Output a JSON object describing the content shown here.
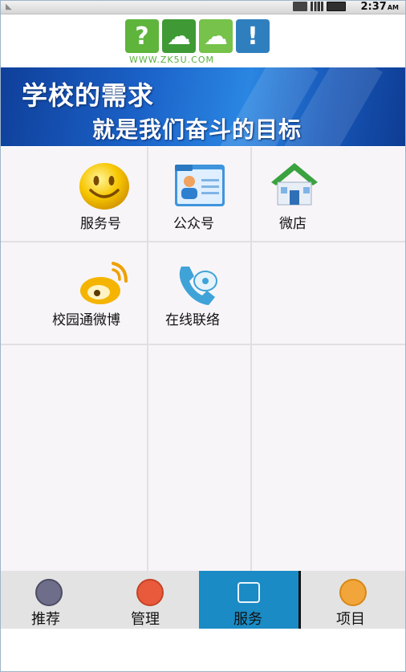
{
  "status_bar": {
    "time": "2:37",
    "ampm": "AM",
    "icons": [
      "usb-icon",
      "signal-icon",
      "battery-icon"
    ]
  },
  "header": {
    "logo_url": "WWW.ZK5U.COM"
  },
  "banner": {
    "line1": "学校的需求",
    "line2": "就是我们奋斗的目标"
  },
  "services": [
    {
      "label": "服务号",
      "icon": "smiley-icon"
    },
    {
      "label": "公众号",
      "icon": "contact-card-icon"
    },
    {
      "label": "微店",
      "icon": "house-icon"
    },
    {
      "label": "校园通微博",
      "icon": "weibo-icon"
    },
    {
      "label": "在线联络",
      "icon": "telephone-icon"
    }
  ],
  "bottom_nav": [
    {
      "label": "推荐",
      "icon": "recommend-icon",
      "active": false
    },
    {
      "label": "管理",
      "icon": "lock-icon",
      "active": false
    },
    {
      "label": "服务",
      "icon": "service-icon",
      "active": true
    },
    {
      "label": "项目",
      "icon": "play-icon",
      "active": false
    }
  ],
  "colors": {
    "accent": "#1a8bc4",
    "banner": "#1b62c8",
    "grid_bg": "#f8f5f8"
  }
}
